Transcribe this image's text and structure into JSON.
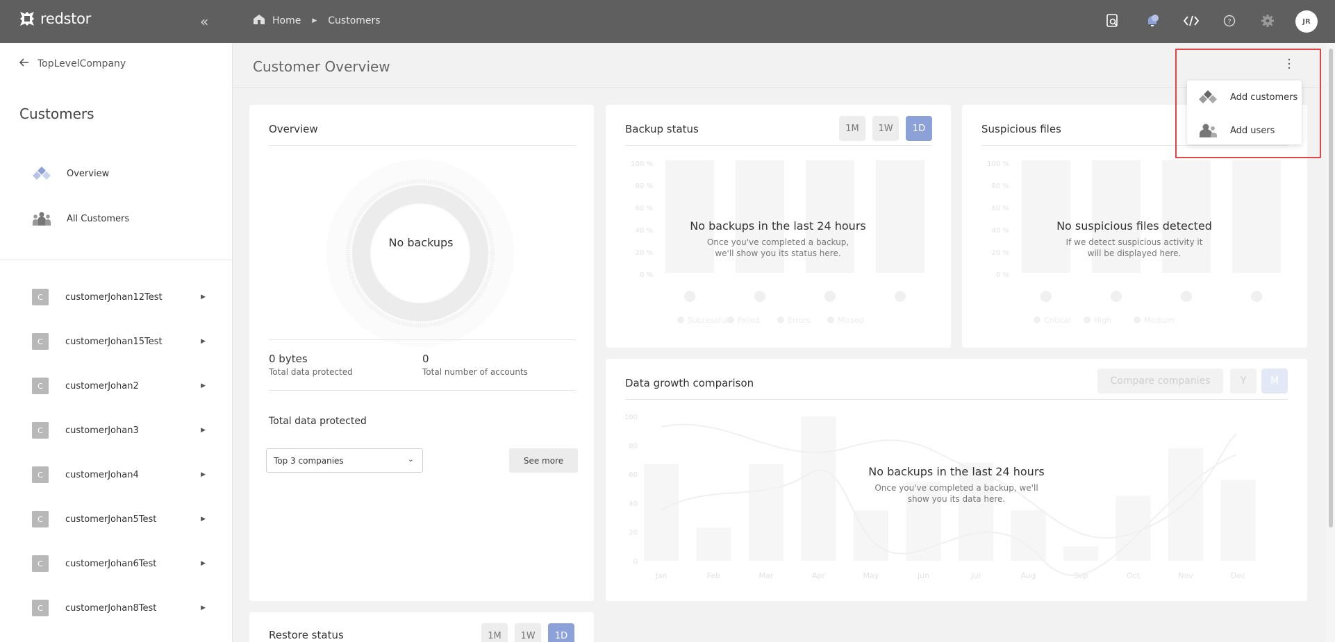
{
  "app": {
    "brand": "redstor"
  },
  "topbar": {
    "breadcrumb": [
      {
        "label": "Home"
      },
      {
        "label": "Customers"
      }
    ],
    "icons": [
      "search-icon",
      "notifications-icon",
      "code-icon",
      "help-icon",
      "settings-icon"
    ],
    "avatar_initials": "JR"
  },
  "sidebar": {
    "back_label": "TopLevelCompany",
    "title": "Customers",
    "nav": [
      {
        "label": "Overview",
        "icon": "overview-icon"
      },
      {
        "label": "All Customers",
        "icon": "people-icon"
      }
    ],
    "customers": [
      {
        "badge": "C",
        "name": "customerJohan12Test"
      },
      {
        "badge": "C",
        "name": "customerJohan15Test"
      },
      {
        "badge": "C",
        "name": "customerJohan2"
      },
      {
        "badge": "C",
        "name": "customerJohan3"
      },
      {
        "badge": "C",
        "name": "customerJohan4"
      },
      {
        "badge": "C",
        "name": "customerJohan5Test"
      },
      {
        "badge": "C",
        "name": "customerJohan6Test"
      },
      {
        "badge": "C",
        "name": "customerJohan8Test"
      }
    ]
  },
  "main": {
    "title": "Customer Overview",
    "overview": {
      "title": "Overview",
      "donut_label": "No backups",
      "stats": [
        {
          "value": "0 bytes",
          "label": "Total data protected"
        },
        {
          "value": "0",
          "label": "Total number of accounts"
        }
      ],
      "section_title": "Total data protected",
      "select_value": "Top 3 companies",
      "see_more": "See more"
    },
    "backup_status": {
      "title": "Backup status",
      "periods": [
        "1M",
        "1W",
        "1D"
      ],
      "active_period": "1D",
      "y_ticks": [
        "100 %",
        "80 %",
        "60 %",
        "40 %",
        "20 %",
        "0 %"
      ],
      "legend": [
        "Successful",
        "Failed",
        "Errors",
        "Missed"
      ],
      "empty_title": "No backups in the last 24 hours",
      "empty_sub": "Once you've completed a backup, we'll show you its status here."
    },
    "suspicious": {
      "title": "Suspicious files",
      "y_ticks": [
        "100 %",
        "80 %",
        "60 %",
        "40 %",
        "20 %",
        "0 %"
      ],
      "legend": [
        "Critical",
        "High",
        "Medium"
      ],
      "empty_title": "No suspicious files detected",
      "empty_sub": "If we detect suspicious activity it will be displayed here."
    },
    "growth": {
      "title": "Data growth comparison",
      "compare_label": "Compare companies",
      "periods": [
        "Y",
        "M"
      ],
      "y_ticks": [
        "100",
        "80",
        "60",
        "40",
        "20",
        "0"
      ],
      "months": [
        "Jan",
        "Feb",
        "Mar",
        "Apr",
        "May",
        "Jun",
        "Jul",
        "Aug",
        "Sep",
        "Oct",
        "Nov",
        "Dec"
      ],
      "empty_title": "No backups in the last 24 hours",
      "empty_sub": "Once you've completed a backup, we'll show you its data here."
    },
    "restore_status": {
      "title": "Restore status",
      "periods": [
        "1M",
        "1W",
        "1D"
      ],
      "active_period": "1D"
    }
  },
  "menu": {
    "items": [
      {
        "label": "Add customers",
        "icon": "add-customers-icon"
      },
      {
        "label": "Add users",
        "icon": "add-users-icon"
      }
    ]
  },
  "colors": {
    "topbar": "#5f5f5f",
    "accent": "#8da1d9",
    "highlight": "#e04545"
  }
}
